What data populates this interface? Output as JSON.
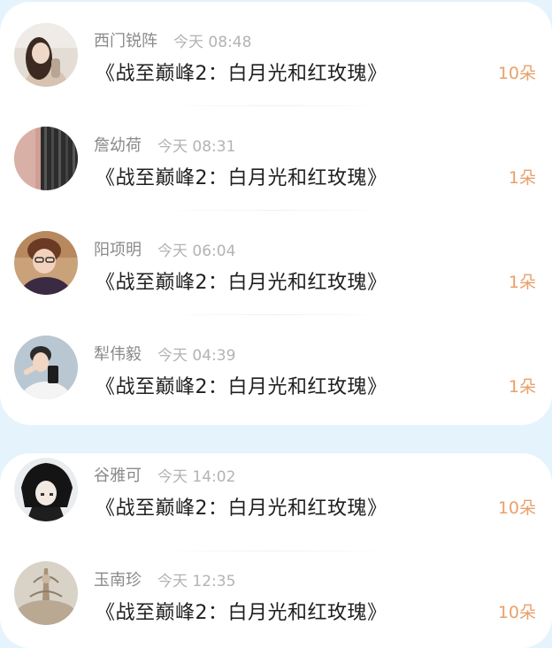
{
  "gift_list_1": [
    {
      "name": "西门锐阵",
      "time": "今天 08:48",
      "title": "《战至巅峰2：白月光和红玫瑰》",
      "count": "10朵",
      "avatar": "woman-portrait-avatar"
    },
    {
      "name": "詹幼荷",
      "time": "今天 08:31",
      "title": "《战至巅峰2：白月光和红玫瑰》",
      "count": "1朵",
      "avatar": "curtain-avatar"
    },
    {
      "name": "阳项明",
      "time": "今天 06:04",
      "title": "《战至巅峰2：白月光和红玫瑰》",
      "count": "1朵",
      "avatar": "man-portrait-avatar"
    },
    {
      "name": "犁伟毅",
      "time": "今天 04:39",
      "title": "《战至巅峰2：白月光和红玫瑰》",
      "count": "1朵",
      "avatar": "selfie-avatar"
    }
  ],
  "gift_list_2": [
    {
      "name": "谷雅可",
      "time": "今天 14:02",
      "title": "《战至巅峰2：白月光和红玫瑰》",
      "count": "10朵",
      "avatar": "anime-character-avatar"
    },
    {
      "name": "玉南珍",
      "time": "今天 12:35",
      "title": "《战至巅峰2：白月光和红玫瑰》",
      "count": "10朵",
      "avatar": "painting-avatar"
    }
  ],
  "colors": {
    "background": "#e4f3fc",
    "card": "#ffffff",
    "count_accent": "#e9a06a",
    "name_text": "#8a8a8a",
    "time_text": "#b3b3b3",
    "title_text": "#1f1f1f"
  }
}
